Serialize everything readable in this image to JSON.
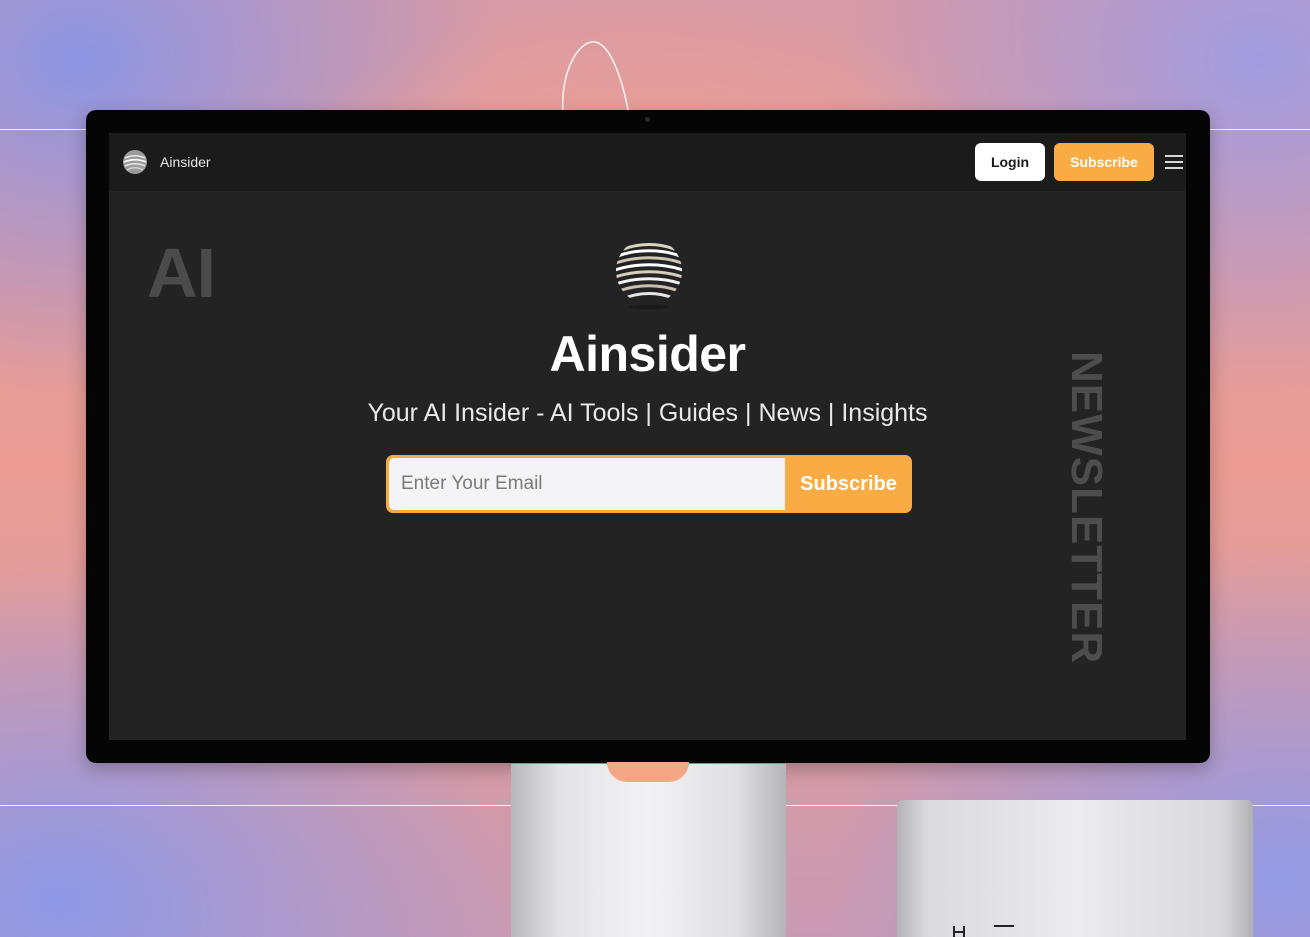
{
  "site": {
    "brand_name": "Ainsider",
    "nav": {
      "login_label": "Login",
      "subscribe_label": "Subscribe"
    },
    "hero": {
      "title": "Ainsider",
      "subtitle": "Your AI Insider - AI Tools | Guides | News | Insights",
      "email_placeholder": "Enter Your Email",
      "subscribe_label": "Subscribe"
    },
    "decor": {
      "bg_word_left": "AI",
      "bg_word_right": "NEWSLETTER"
    }
  },
  "colors": {
    "accent": "#f9ac44",
    "screen_bg": "#232323",
    "nav_bg": "#1b1b1b"
  },
  "icons": [
    "ainsider-logo-icon",
    "hamburger-menu-icon"
  ]
}
